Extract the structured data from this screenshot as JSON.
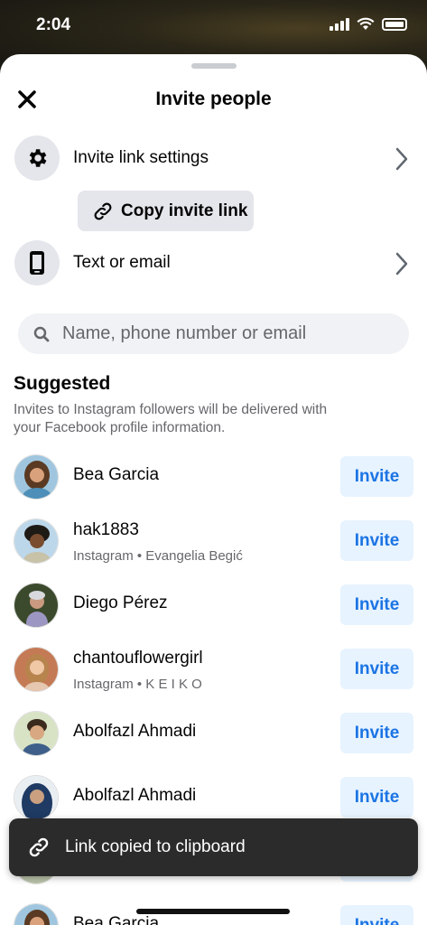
{
  "status_bar": {
    "time": "2:04"
  },
  "header": {
    "title": "Invite people"
  },
  "options": {
    "invite_link_settings": "Invite link settings",
    "copy_invite_link": "Copy invite link",
    "text_or_email": "Text or email"
  },
  "search": {
    "placeholder": "Name, phone number or email"
  },
  "suggested": {
    "title": "Suggested",
    "description": "Invites to Instagram followers will be delivered with your Facebook profile information.",
    "invite_label": "Invite",
    "items": [
      {
        "name": "Bea Garcia",
        "subtitle": ""
      },
      {
        "name": "hak1883",
        "subtitle": "Instagram • Evangelia Begić"
      },
      {
        "name": "Diego Pérez",
        "subtitle": ""
      },
      {
        "name": "chantouflowergirl",
        "subtitle": "Instagram • K E I K O"
      },
      {
        "name": "Abolfazl Ahmadi",
        "subtitle": ""
      },
      {
        "name": "Abolfazl Ahmadi",
        "subtitle": ""
      },
      {
        "name": "",
        "subtitle": ""
      },
      {
        "name": "Bea Garcia",
        "subtitle": ""
      }
    ]
  },
  "toast": {
    "message": "Link copied to clipboard"
  },
  "colors": {
    "accent": "#1b74e4",
    "invite_bg": "#e7f3ff",
    "toast_bg": "#2b2b2b"
  }
}
